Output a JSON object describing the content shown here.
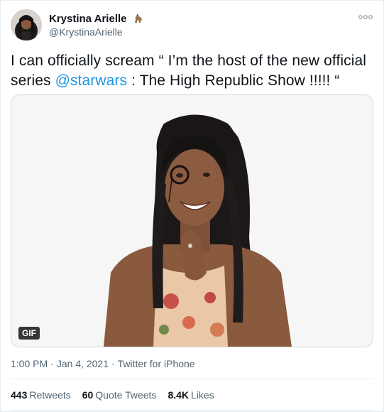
{
  "user": {
    "display_name": "Krystina Arielle",
    "name_emoji": "dinosaur-emoji-icon",
    "handle": "@KrystinaArielle"
  },
  "tweet": {
    "text_before": "I can officially scream “ I’m the host of the new official series ",
    "mention": "@starwars",
    "text_after": " : The High Republic Show !!!!! “"
  },
  "media": {
    "badge": "GIF"
  },
  "meta": {
    "time": "1:00 PM",
    "separator": "·",
    "date": "Jan 4, 2021",
    "source": "Twitter for iPhone"
  },
  "stats": {
    "retweets_count": "443",
    "retweets_label": "Retweets",
    "quotes_count": "60",
    "quotes_label": "Quote Tweets",
    "likes_count": "8.4K",
    "likes_label": "Likes"
  },
  "colors": {
    "link": "#1b95e0",
    "text": "#0f1419",
    "secondary": "#536471",
    "border": "#e6ecf0"
  }
}
